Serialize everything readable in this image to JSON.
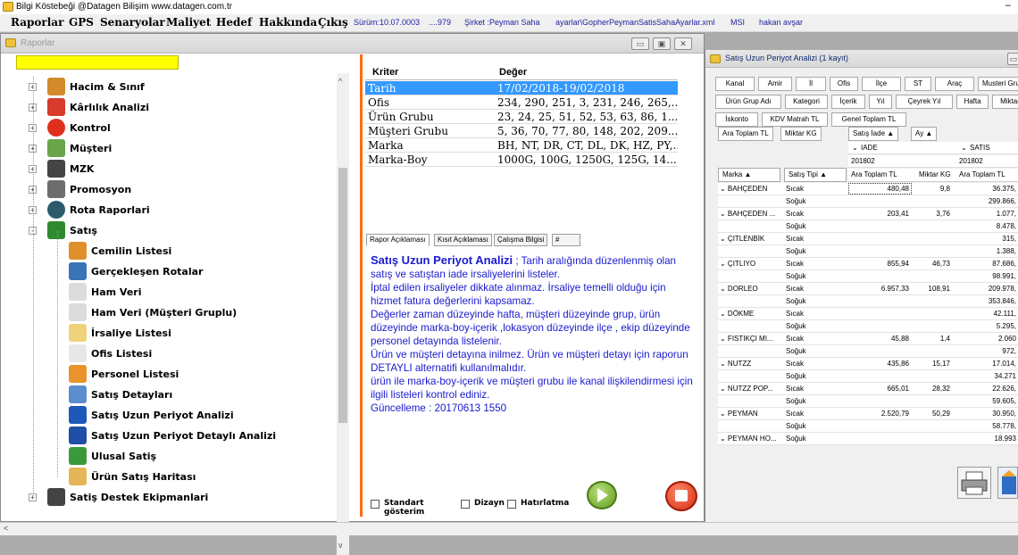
{
  "app": {
    "title": "Bilgi Köstebeği @Datagen Bilişim  www.datagen.com.tr",
    "minimize": "–"
  },
  "menu": {
    "items": [
      "Raporlar",
      "GPS",
      "Senaryolar",
      "Maliyet",
      "Hedef",
      "Hakkında",
      "Çıkış"
    ],
    "info": {
      "version": "Sürüm:10.07.0003",
      "code": "....979",
      "company": "Şirket :Peyman Saha",
      "config": "ayarlar\\GopherPeymanSatisSahaAyarlar.xml",
      "msi": "MSI",
      "user": "hakan avşar"
    }
  },
  "raporlar_window": {
    "title": "Raporlar",
    "search_value": "",
    "tree": [
      {
        "label": "Hacim & Sınıf",
        "icon": "barrel-icon",
        "level": 0,
        "expander": "+"
      },
      {
        "label": "Kârlılık Analizi",
        "icon": "trend-chart-icon",
        "level": 0,
        "expander": "+"
      },
      {
        "label": "Kontrol",
        "icon": "warning-icon",
        "level": 0,
        "expander": "+"
      },
      {
        "label": "Müşteri",
        "icon": "customers-icon",
        "level": 0,
        "expander": "+"
      },
      {
        "label": "MZK",
        "icon": "store-icon",
        "level": 0,
        "expander": "+"
      },
      {
        "label": "Promosyon",
        "icon": "gift-icon",
        "level": 0,
        "expander": "+"
      },
      {
        "label": "Rota Raporlari",
        "icon": "globe-icon",
        "level": 0,
        "expander": "+"
      },
      {
        "label": "Satış",
        "icon": "folder-icon",
        "level": 0,
        "expander": "-"
      },
      {
        "label": "Cemilin Listesi",
        "icon": "person-icon",
        "level": 1
      },
      {
        "label": "Gerçekleşen Rotalar",
        "icon": "route-icon",
        "level": 1
      },
      {
        "label": "Ham Veri",
        "icon": "document-icon",
        "level": 1
      },
      {
        "label": "Ham Veri (Müşteri Gruplu)",
        "icon": "document-icon",
        "level": 1
      },
      {
        "label": "İrsaliye Listesi",
        "icon": "pencil-icon",
        "level": 1
      },
      {
        "label": "Ofis Listesi",
        "icon": "office-icon",
        "level": 1
      },
      {
        "label": "Personel Listesi",
        "icon": "staff-icon",
        "level": 1
      },
      {
        "label": "Satış Detayları",
        "icon": "magnifier-icon",
        "level": 1
      },
      {
        "label": "Satış Uzun Periyot Analizi",
        "icon": "double-chevron-icon",
        "level": 1
      },
      {
        "label": "Satış Uzun Periyot Detaylı Analizi",
        "icon": "bar-chart-icon",
        "level": 1
      },
      {
        "label": "Ulusal Satiş",
        "icon": "national-icon",
        "level": 1
      },
      {
        "label": "Ürün Satış Haritası",
        "icon": "map-icon",
        "level": 1
      },
      {
        "label": "Satiş Destek Ekipmanlari",
        "icon": "cooler-icon",
        "level": 0,
        "expander": "+"
      }
    ],
    "kriter_header": {
      "col1": "Kriter",
      "col2": "Değer"
    },
    "kriter_rows": [
      {
        "k": "Tarih",
        "v": "17/02/2018-19/02/2018"
      },
      {
        "k": "Ofis",
        "v": "234, 290, 251, 3, 231, 246, 265,..."
      },
      {
        "k": "Ürün Grubu",
        "v": "23, 24, 25, 51, 52, 53, 63, 86, 1..."
      },
      {
        "k": "Müşteri Grubu",
        "v": "5, 36, 70, 77, 80, 148, 202, 209..."
      },
      {
        "k": "Marka",
        "v": "BH, NT, DR, CT, DL, DK, HZ, PY,..."
      },
      {
        "k": "Marka-Boy",
        "v": "1000G, 100G, 1250G, 125G, 14..."
      }
    ],
    "tabs": [
      "Rapor Açıklaması",
      "Kısıt Açıklaması",
      "Çalışma Bilgisi",
      "#"
    ],
    "description": {
      "heading": "Satış Uzun Periyot Analizi",
      "lines": [
        " ; Tarih aralığında düzenlenmiş olan satış ve satıştan iade irsaliyelerini listeler.",
        "İptal edilen irsaliyeler dikkate alınmaz. İrsaliye temelli olduğu için hizmet fatura değerlerini kapsamaz.",
        "Değerler zaman düzeyinde hafta, müşteri düzeyinde grup, ürün düzeyinde marka-boy-içerik ,lokasyon düzeyinde ilçe , ekip düzeyinde personel detayında listelenir.",
        "Ürün ve müşteri detayına inilmez. Ürün ve müşteri detayı için raporun DETAYLI alternatifi kullanılmalıdır.",
        "ürün ile marka-boy-içerik ve müşteri grubu ile kanal ilişkilendirmesi için ilgili listeleri kontrol ediniz.",
        "Güncelleme : 20170613 1550"
      ]
    },
    "checkboxes": [
      "Standart gösterim",
      "Dizayn",
      "Hatırlatma"
    ]
  },
  "satis_window": {
    "title": "Satış Uzun Periyot Analizi (1 kayıt)",
    "filter_rows": [
      [
        "Kanal",
        "Amir",
        "İl",
        "Ofis",
        "İlçe",
        "ST",
        "Araç",
        "Musteri Grubu"
      ],
      [
        "Ürün Grup Adı",
        "Kategori",
        "İçerik",
        "Yıl",
        "Çeyrek Yıl",
        "Hafta",
        "Miktar"
      ],
      [
        "İskonto",
        "KDV Matrah TL",
        "Genel Toplam TL"
      ]
    ],
    "data_fields": [
      "Ara Toplam TL",
      "Miktar KG"
    ],
    "col_fields": [
      "Satış İade ▲",
      "Ay ▲"
    ],
    "col_groups": {
      "iade": "IADE",
      "satis": "SATIS",
      "period": "201802"
    },
    "row_fields": [
      "Marka ▲",
      "Satış Tipi ▲"
    ],
    "measure_headers": [
      "Ara Toplam TL",
      "Miktar KG",
      "Ara Toplam TL"
    ],
    "rows": [
      {
        "marka": "BAHÇEDEN",
        "tip": "Sıcak",
        "iade_tl": "480,48",
        "iade_kg": "9,8",
        "satis_tl": "36.375,"
      },
      {
        "marka": "",
        "tip": "Soğuk",
        "iade_tl": "",
        "iade_kg": "",
        "satis_tl": "299.866,"
      },
      {
        "marka": "BAHÇEDEN ...",
        "tip": "Sıcak",
        "iade_tl": "203,41",
        "iade_kg": "3,76",
        "satis_tl": "1.077,"
      },
      {
        "marka": "",
        "tip": "Soğuk",
        "iade_tl": "",
        "iade_kg": "",
        "satis_tl": "8.478,"
      },
      {
        "marka": "ÇITLENBİK",
        "tip": "Sıcak",
        "iade_tl": "",
        "iade_kg": "",
        "satis_tl": "315,"
      },
      {
        "marka": "",
        "tip": "Soğuk",
        "iade_tl": "",
        "iade_kg": "",
        "satis_tl": "1.388,"
      },
      {
        "marka": "ÇITLIYO",
        "tip": "Sıcak",
        "iade_tl": "855,94",
        "iade_kg": "46,73",
        "satis_tl": "87.686,"
      },
      {
        "marka": "",
        "tip": "Soğuk",
        "iade_tl": "",
        "iade_kg": "",
        "satis_tl": "98.991,"
      },
      {
        "marka": "DORLEO",
        "tip": "Sıcak",
        "iade_tl": "6.957,33",
        "iade_kg": "108,91",
        "satis_tl": "209.978,"
      },
      {
        "marka": "",
        "tip": "Soğuk",
        "iade_tl": "",
        "iade_kg": "",
        "satis_tl": "353.846,"
      },
      {
        "marka": "DÖKME",
        "tip": "Sıcak",
        "iade_tl": "",
        "iade_kg": "",
        "satis_tl": "42.111,"
      },
      {
        "marka": "",
        "tip": "Soğuk",
        "iade_tl": "",
        "iade_kg": "",
        "satis_tl": "5.295,"
      },
      {
        "marka": "FISTIKÇI MI...",
        "tip": "Sıcak",
        "iade_tl": "45,88",
        "iade_kg": "1,4",
        "satis_tl": "2.060"
      },
      {
        "marka": "",
        "tip": "Soğuk",
        "iade_tl": "",
        "iade_kg": "",
        "satis_tl": "972,"
      },
      {
        "marka": "NUTZZ",
        "tip": "Sıcak",
        "iade_tl": "435,86",
        "iade_kg": "15,17",
        "satis_tl": "17.014,"
      },
      {
        "marka": "",
        "tip": "Soğuk",
        "iade_tl": "",
        "iade_kg": "",
        "satis_tl": "34.271"
      },
      {
        "marka": "NUTZZ POP...",
        "tip": "Sıcak",
        "iade_tl": "665,01",
        "iade_kg": "28,32",
        "satis_tl": "22.626,"
      },
      {
        "marka": "",
        "tip": "Soğuk",
        "iade_tl": "",
        "iade_kg": "",
        "satis_tl": "59.605,"
      },
      {
        "marka": "PEYMAN",
        "tip": "Sıcak",
        "iade_tl": "2.520,79",
        "iade_kg": "50,29",
        "satis_tl": "30.950,"
      },
      {
        "marka": "",
        "tip": "Soğuk",
        "iade_tl": "",
        "iade_kg": "",
        "satis_tl": "58.778,"
      },
      {
        "marka": "PEYMAN HO...",
        "tip": "Soğuk",
        "iade_tl": "",
        "iade_kg": "",
        "satis_tl": "18.993"
      }
    ]
  },
  "colors": {
    "selection": "#3399ff",
    "description_text": "#1a1acf",
    "accent_line": "#ff6a14",
    "search_highlight": "#ffff00"
  }
}
